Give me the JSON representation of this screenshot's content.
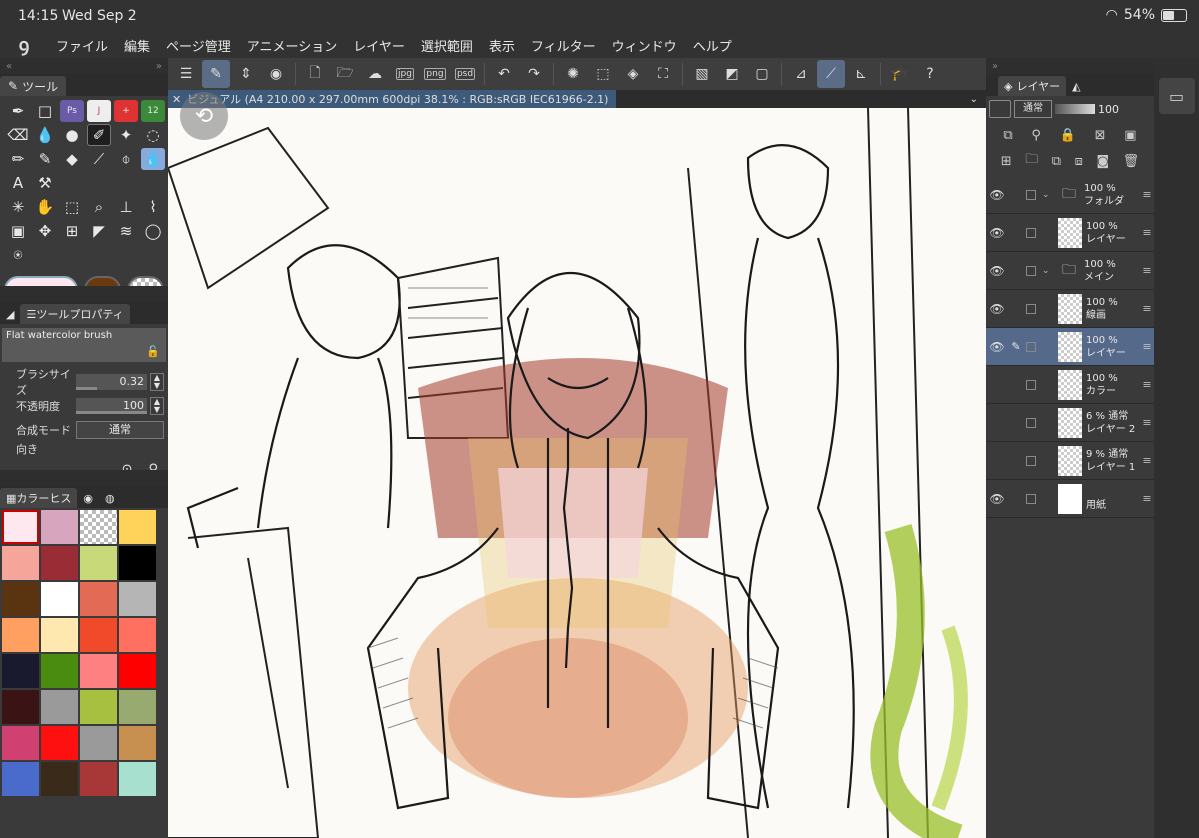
{
  "status": {
    "time": "14:15",
    "date": "Wed Sep 2",
    "battery": "54%",
    "battery_level": 54
  },
  "menu": [
    "ファイル",
    "編集",
    "ページ管理",
    "アニメーション",
    "レイヤー",
    "選択範囲",
    "表示",
    "フィルター",
    "ウィンドウ",
    "ヘルプ"
  ],
  "tools_panel": {
    "title": "ツール"
  },
  "tool_property": {
    "tab": "ツールプロパティ",
    "brush_name": "Flat watercolor brush",
    "brush_size_label": "ブラシサイズ",
    "brush_size_value": "0.32",
    "opacity_label": "不透明度",
    "opacity_value": "100",
    "blend_label": "合成モード",
    "blend_value": "通常",
    "next_label": "向き"
  },
  "color_history": {
    "tab": "カラーヒス",
    "colors": [
      "#fde8ef",
      "#d8a5bf",
      "checker",
      "#ffd25a",
      "#f6a59a",
      "#9a2c36",
      "#c8d97a",
      "#000000",
      "#5a3410",
      "#ffffff",
      "#e36a55",
      "#b5b5b5",
      "#ffa060",
      "#ffe8b0",
      "#f04a2a",
      "#ff7060",
      "#1a1a2e",
      "#4a8c10",
      "#ff8080",
      "#ff0000",
      "#3a1414",
      "#9a9a9a",
      "#a8c040",
      "#98aa70",
      "#d04070",
      "#ff1010",
      "#9a9a9a",
      "#c89050",
      "#4a6acc",
      "#3a2a1a",
      "#a83838",
      "#a8e0d0"
    ]
  },
  "doc_tab": {
    "title": "ビジュアル (A4 210.00 x 297.00mm 600dpi 38.1% : RGB:sRGB IEC61966-2.1)"
  },
  "layer_panel": {
    "tab": "レイヤー",
    "blend": "通常",
    "opacity": "100",
    "layers": [
      {
        "pct": "100 %",
        "name": "フォルダ",
        "kind": "folder",
        "visible": true,
        "selected": false
      },
      {
        "pct": "100 %",
        "name": "レイヤー",
        "kind": "layer",
        "visible": true,
        "selected": false
      },
      {
        "pct": "100 %",
        "name": "メイン",
        "kind": "folder",
        "visible": true,
        "selected": false
      },
      {
        "pct": "100 %",
        "name": "線画",
        "kind": "sketch",
        "visible": true,
        "selected": false
      },
      {
        "pct": "100 %",
        "name": "レイヤー",
        "kind": "layer",
        "visible": true,
        "selected": true
      },
      {
        "pct": "100 %",
        "name": "カラー",
        "kind": "color",
        "visible": false,
        "selected": false
      },
      {
        "pct": "6 % 通常",
        "name": "レイヤー 2",
        "kind": "sketch",
        "visible": false,
        "selected": false
      },
      {
        "pct": "9 % 通常",
        "name": "レイヤー 1",
        "kind": "sketch",
        "visible": false,
        "selected": false
      },
      {
        "pct": "",
        "name": "用紙",
        "kind": "paper",
        "visible": true,
        "selected": false
      }
    ]
  },
  "colors": {
    "accent": "#5b6d86",
    "selected_layer": "#55698a"
  }
}
